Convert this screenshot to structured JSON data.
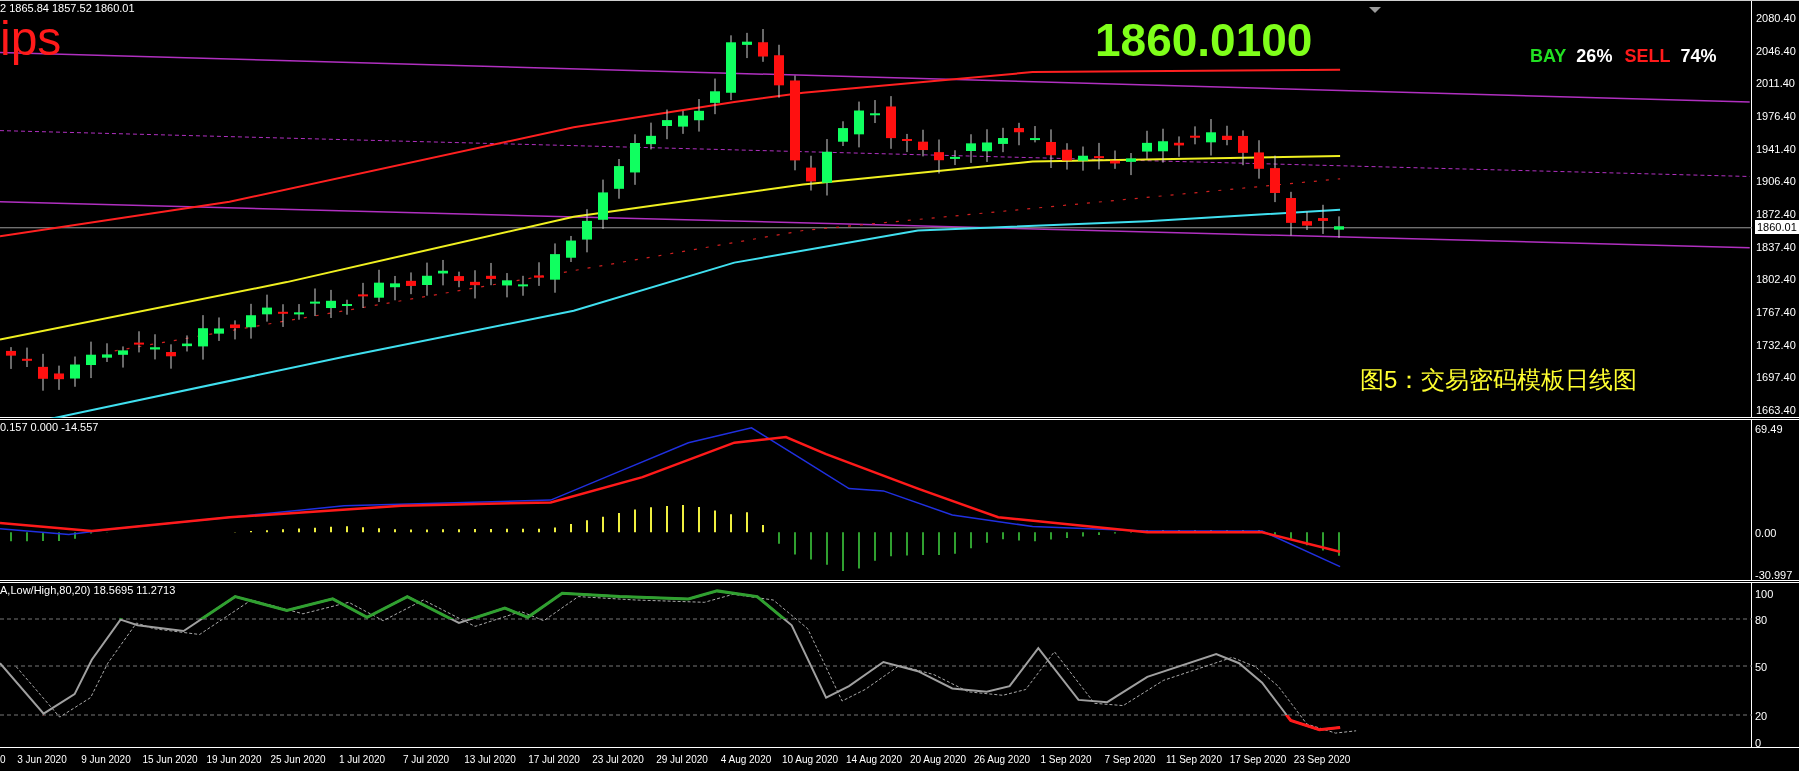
{
  "header": {
    "ohlc": "2 1865.84 1857.52 1860.01"
  },
  "logo_text": "ips",
  "price": "1860.0100",
  "sentiment": [
    {
      "kind": "buy",
      "label": "BAY",
      "value": "26%"
    },
    {
      "kind": "sell",
      "label": "SELL",
      "value": "74%"
    }
  ],
  "caption": "图5：交易密码模板日线图",
  "price_axis": {
    "labels": [
      "2080.40",
      "2046.40",
      "2011.40",
      "1976.40",
      "1941.40",
      "1906.40",
      "1872.40",
      "1837.40",
      "1802.40",
      "1767.40",
      "1732.40",
      "1697.40",
      "1663.40"
    ],
    "current": "1860.01"
  },
  "macd": {
    "readout": "0.157 0.000 -14.557",
    "axis": [
      "69.49",
      "0.00",
      "-30.997"
    ]
  },
  "stochastic": {
    "readout": "A,Low/High,80,20) 18.5695 11.2713",
    "axis": [
      "100",
      "80",
      "50",
      "20",
      "0"
    ]
  },
  "time_axis": [
    "0",
    "3 Jun 2020",
    "9 Jun 2020",
    "15 Jun 2020",
    "19 Jun 2020",
    "25 Jun 2020",
    "1 Jul 2020",
    "7 Jul 2020",
    "13 Jul 2020",
    "17 Jul 2020",
    "23 Jul 2020",
    "29 Jul 2020",
    "4 Aug 2020",
    "10 Aug 2020",
    "14 Aug 2020",
    "20 Aug 2020",
    "26 Aug 2020",
    "1 Sep 2020",
    "7 Sep 2020",
    "11 Sep 2020",
    "17 Sep 2020",
    "23 Sep 2020"
  ]
}
